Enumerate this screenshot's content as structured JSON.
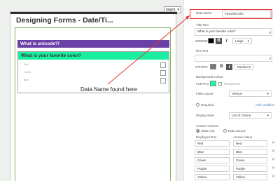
{
  "designer": {
    "title": "Designing Forms - Date/Ti...",
    "page_select": "page1",
    "questions": [
      {
        "label": "What is unicode?!",
        "color": "#6a3fa6",
        "controls": ""
      },
      {
        "label": "What is your favorite color?",
        "color": "#1aeea1",
        "options": [
          "Red",
          "Green",
          "Blue"
        ]
      }
    ],
    "callout": "Data Name found here"
  },
  "panel": {
    "data_name_label": "Data Name",
    "data_name_value": "FavoriteColor",
    "title_text_label": "Title Text",
    "title_text_value": "What is your favorite color?",
    "title_color": "#000000",
    "title_size": "Large",
    "hint_text_label": "Hint Text",
    "hint_color": "#787878",
    "hint_size": "Medium",
    "bg_label": "Background Colour",
    "bg_value": "#14FFA1",
    "bg_color": "#14ffa1",
    "transparent_label": "Transparent",
    "field_layout_label": "Field Layout",
    "field_layout_value": "Vertical",
    "required_label": "Required",
    "add_condition_label": "Add condition",
    "display_style_label": "Display Style",
    "display_style_value": "List of Choice",
    "answer_choices_label": "Answer Choices",
    "static_list_label": "Static List",
    "data_source_label": "Data Source",
    "displayed_text_header": "Displayed Text",
    "answer_value_header": "Answer Value",
    "choices": [
      {
        "text": "Red",
        "value": "Red"
      },
      {
        "text": "Blue",
        "value": "Blue"
      },
      {
        "text": "Green",
        "value": "Green"
      },
      {
        "text": "Purple",
        "value": "Purple"
      },
      {
        "text": "Yellow",
        "value": "Yellow"
      }
    ]
  },
  "colors": {
    "highlight": "#e53535",
    "form_border": "#7ab85a"
  }
}
